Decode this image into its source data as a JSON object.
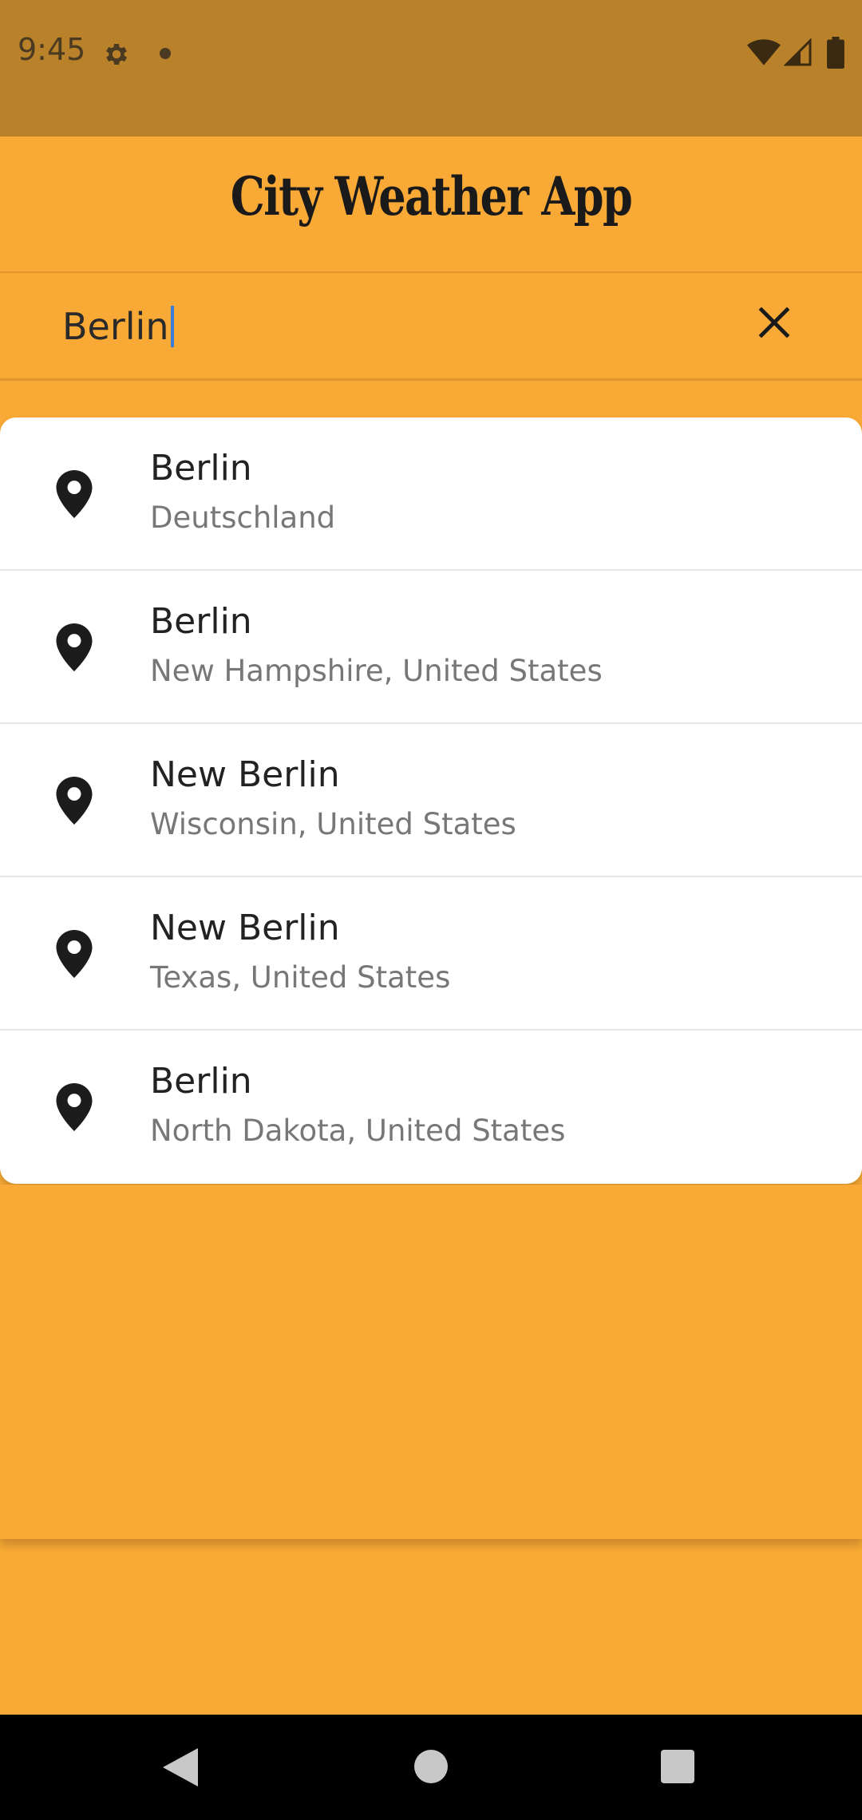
{
  "status_bar": {
    "time": "9:45",
    "icons": [
      "gear-icon",
      "notification-dot-icon",
      "wifi-icon",
      "signal-icon",
      "battery-icon"
    ]
  },
  "app_bar": {
    "title": "City Weather App"
  },
  "search": {
    "value": "Berlin",
    "clear_icon": "close-icon"
  },
  "results": [
    {
      "title": "Berlin",
      "subtitle": "Deutschland",
      "icon": "location-pin-icon"
    },
    {
      "title": "Berlin",
      "subtitle": "New Hampshire, United States",
      "icon": "location-pin-icon"
    },
    {
      "title": "New Berlin",
      "subtitle": "Wisconsin, United States",
      "icon": "location-pin-icon"
    },
    {
      "title": "New Berlin",
      "subtitle": "Texas, United States",
      "icon": "location-pin-icon"
    },
    {
      "title": "Berlin",
      "subtitle": "North Dakota, United States",
      "icon": "location-pin-icon"
    }
  ],
  "nav_bar": {
    "icons": [
      "back-icon",
      "home-icon",
      "recents-icon"
    ]
  },
  "colors": {
    "background": "#F9A935",
    "status_bar": "#B8812A",
    "card": "#FFFFFF",
    "caret": "#3B7DDD"
  }
}
